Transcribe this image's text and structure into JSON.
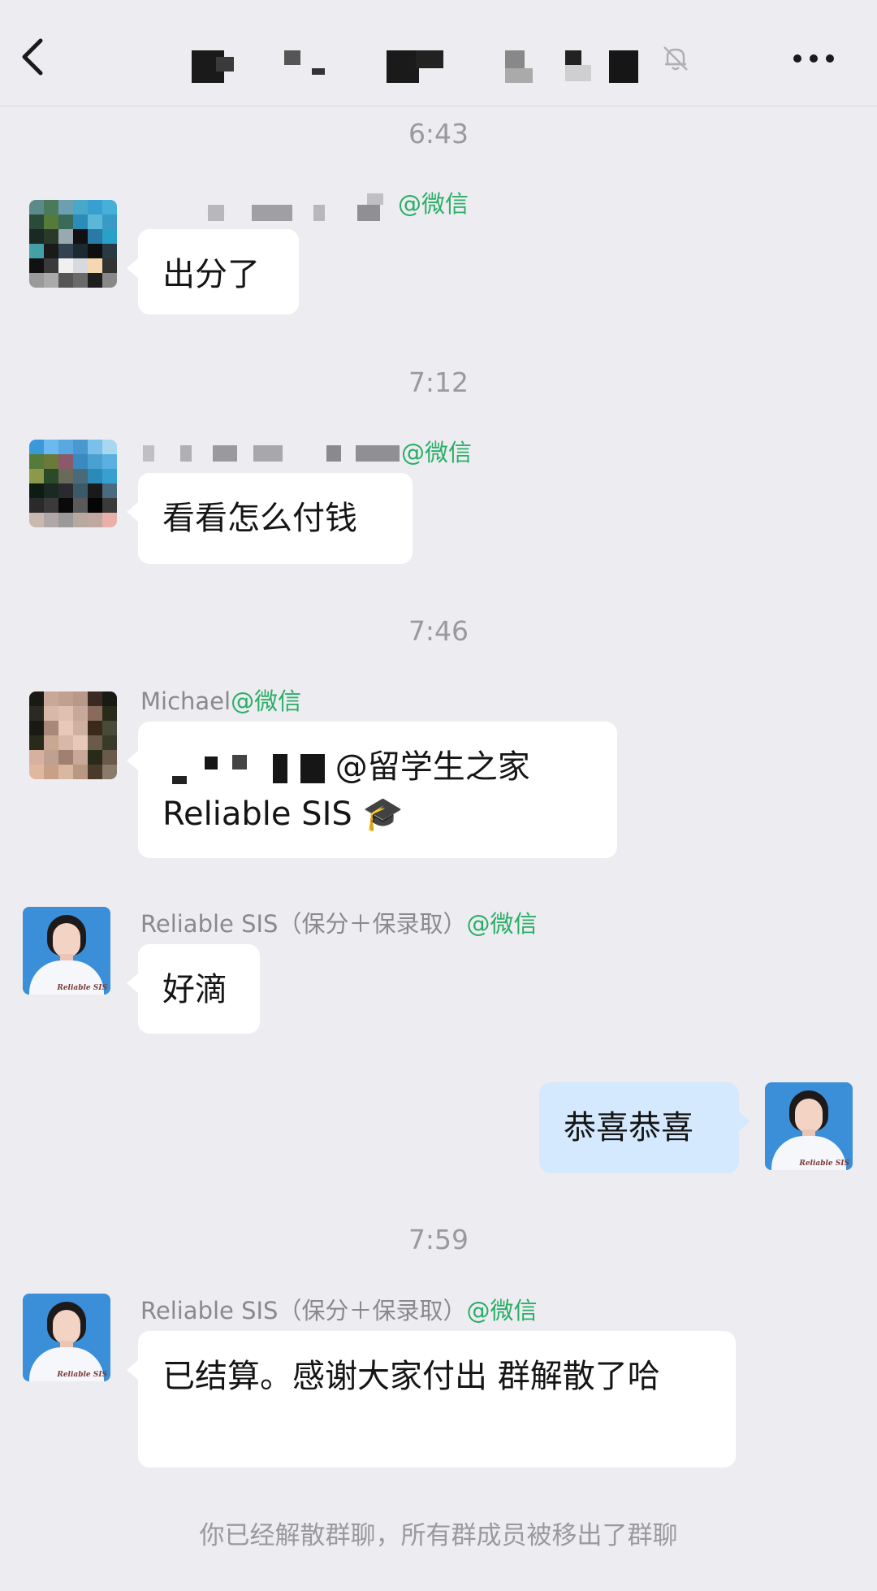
{
  "header": {
    "back_icon": "chevron-left-icon",
    "mute_icon": "bell-muted-icon",
    "more_icon": "more-dots-icon"
  },
  "messages": [
    {
      "time": "6:43",
      "sender_tag": "@微信",
      "text": "出分了"
    },
    {
      "time": "7:12",
      "sender_tag": "@微信",
      "text": "看看怎么付钱"
    },
    {
      "time": "7:46",
      "sender_name": "Michael",
      "sender_tag": "@微信",
      "mention": "@留学生之家",
      "text_line2": "Reliable SIS 🎓"
    },
    {
      "sender_name": "Reliable SIS（保分＋保录取）",
      "sender_tag": "@微信",
      "text": "好滴"
    },
    {
      "self": true,
      "text": "恭喜恭喜"
    },
    {
      "time": "7:59",
      "sender_name": "Reliable SIS（保分＋保录取）",
      "sender_tag": "@微信",
      "text": "已结算。感谢大家付出 群解散了哈"
    }
  ],
  "system_notice": "你已经解散群聊，所有群成员被移出了群聊",
  "avatar_watermark": "Reliable SIS"
}
